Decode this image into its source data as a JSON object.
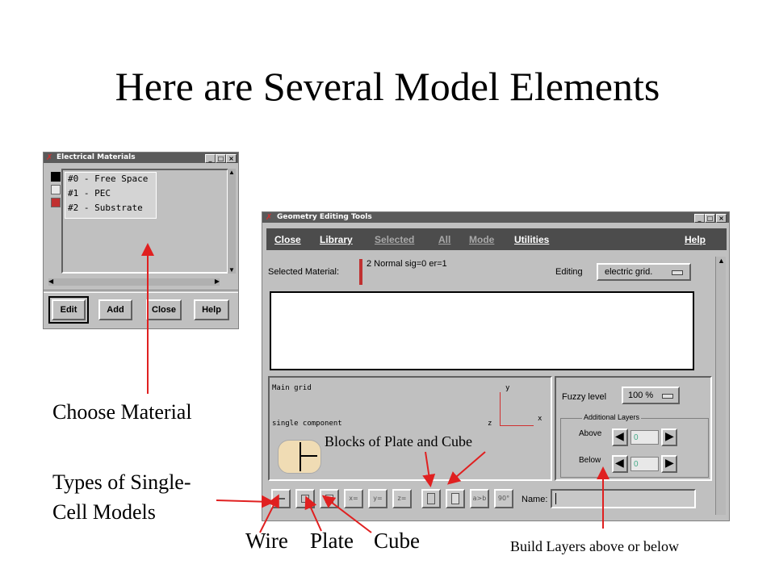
{
  "slide": {
    "title": "Here are Several Model Elements",
    "captions": {
      "choose_material": "Choose Material",
      "types_line1": "Types of Single-",
      "types_line2": "Cell  Models",
      "wire": "Wire",
      "plate": "Plate",
      "cube": "Cube",
      "blocks": "Blocks of Plate  and Cube",
      "build_layers": "Build Layers above or below"
    }
  },
  "materials_window": {
    "title": "Electrical Materials",
    "items": [
      "#0 - Free Space",
      "#1 - PEC",
      "#2 - Substrate"
    ],
    "swatch_colors": [
      "#000000",
      "#e8e8e8",
      "#c03030"
    ],
    "buttons": {
      "edit": "Edit",
      "add": "Add",
      "close": "Close",
      "help": "Help"
    }
  },
  "geometry_window": {
    "title": "Geometry Editing Tools",
    "menu": {
      "close": "Close",
      "library": "Library",
      "selected": "Selected",
      "all": "All",
      "mode": "Mode",
      "utilities": "Utilities",
      "help": "Help"
    },
    "selected_material_label": "Selected Material:",
    "selected_material_value": "2 Normal sig=0 er=1",
    "editing_label": "Editing",
    "editing_value": "electric grid.",
    "grid_panel": {
      "main_grid": "Main grid",
      "single_component": "single component",
      "axis_y": "y",
      "axis_x": "x",
      "axis_z": "z"
    },
    "fuzzy_label": "Fuzzy level",
    "fuzzy_value": "100 %",
    "additional_layers_title": "Additional Layers",
    "above_label": "Above",
    "below_label": "Below",
    "above_value": "0",
    "below_value": "0",
    "toolbar_labels": [
      "x=",
      "y=",
      "z=",
      "a>b",
      "90°"
    ],
    "name_label": "Name:",
    "name_value": ""
  },
  "colors": {
    "window_bg": "#c0c0c0",
    "menubar_bg": "#4c4c4c",
    "arrow_red": "#e02020",
    "material_red": "#c03030"
  }
}
